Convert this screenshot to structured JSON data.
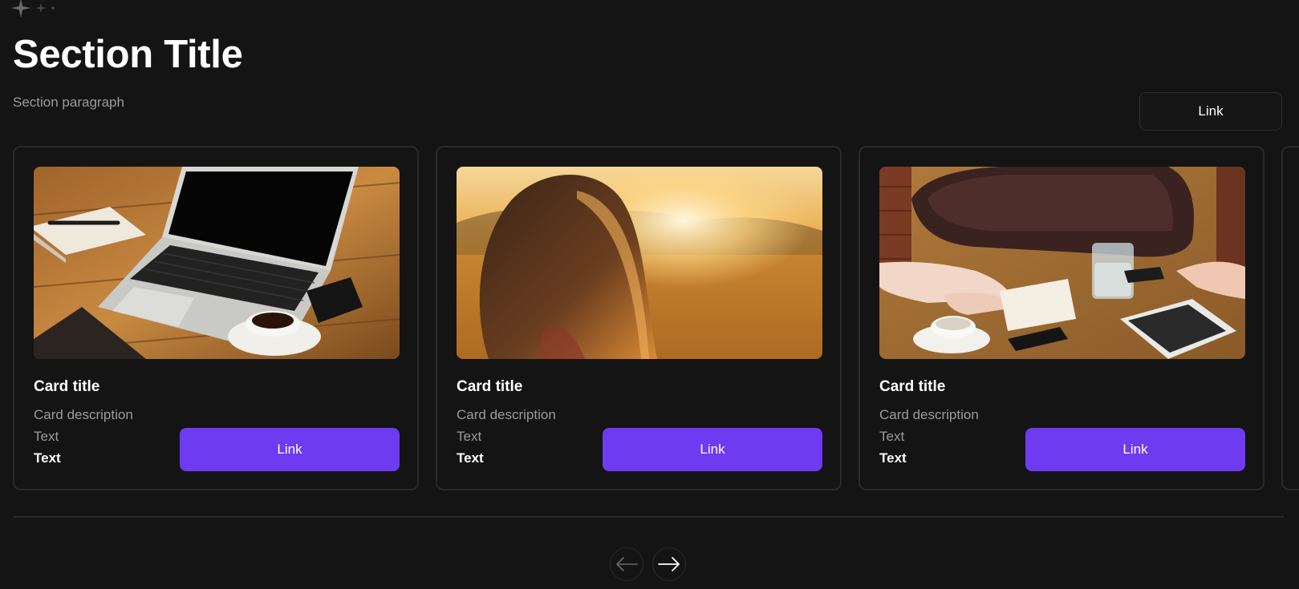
{
  "header": {
    "title": "Section Title",
    "paragraph": "Section paragraph",
    "link_label": "Link"
  },
  "cards": [
    {
      "title": "Card title",
      "description": "Card description",
      "text": "Text",
      "text_bold": "Text",
      "link_label": "Link",
      "image": "laptop-on-wooden-table-photo"
    },
    {
      "title": "Card title",
      "description": "Card description",
      "text": "Text",
      "text_bold": "Text",
      "link_label": "Link",
      "image": "girl-in-sunset-field-photo"
    },
    {
      "title": "Card title",
      "description": "Card description",
      "text": "Text",
      "text_bold": "Text",
      "link_label": "Link",
      "image": "people-writing-at-cafe-table-photo"
    }
  ],
  "carousel": {
    "prev_icon": "arrow-left-icon",
    "next_icon": "arrow-right-icon"
  },
  "colors": {
    "background": "#141414",
    "accent": "#6e3bf0",
    "muted_text": "#9b9b9b",
    "border": "#2a2a2a"
  }
}
